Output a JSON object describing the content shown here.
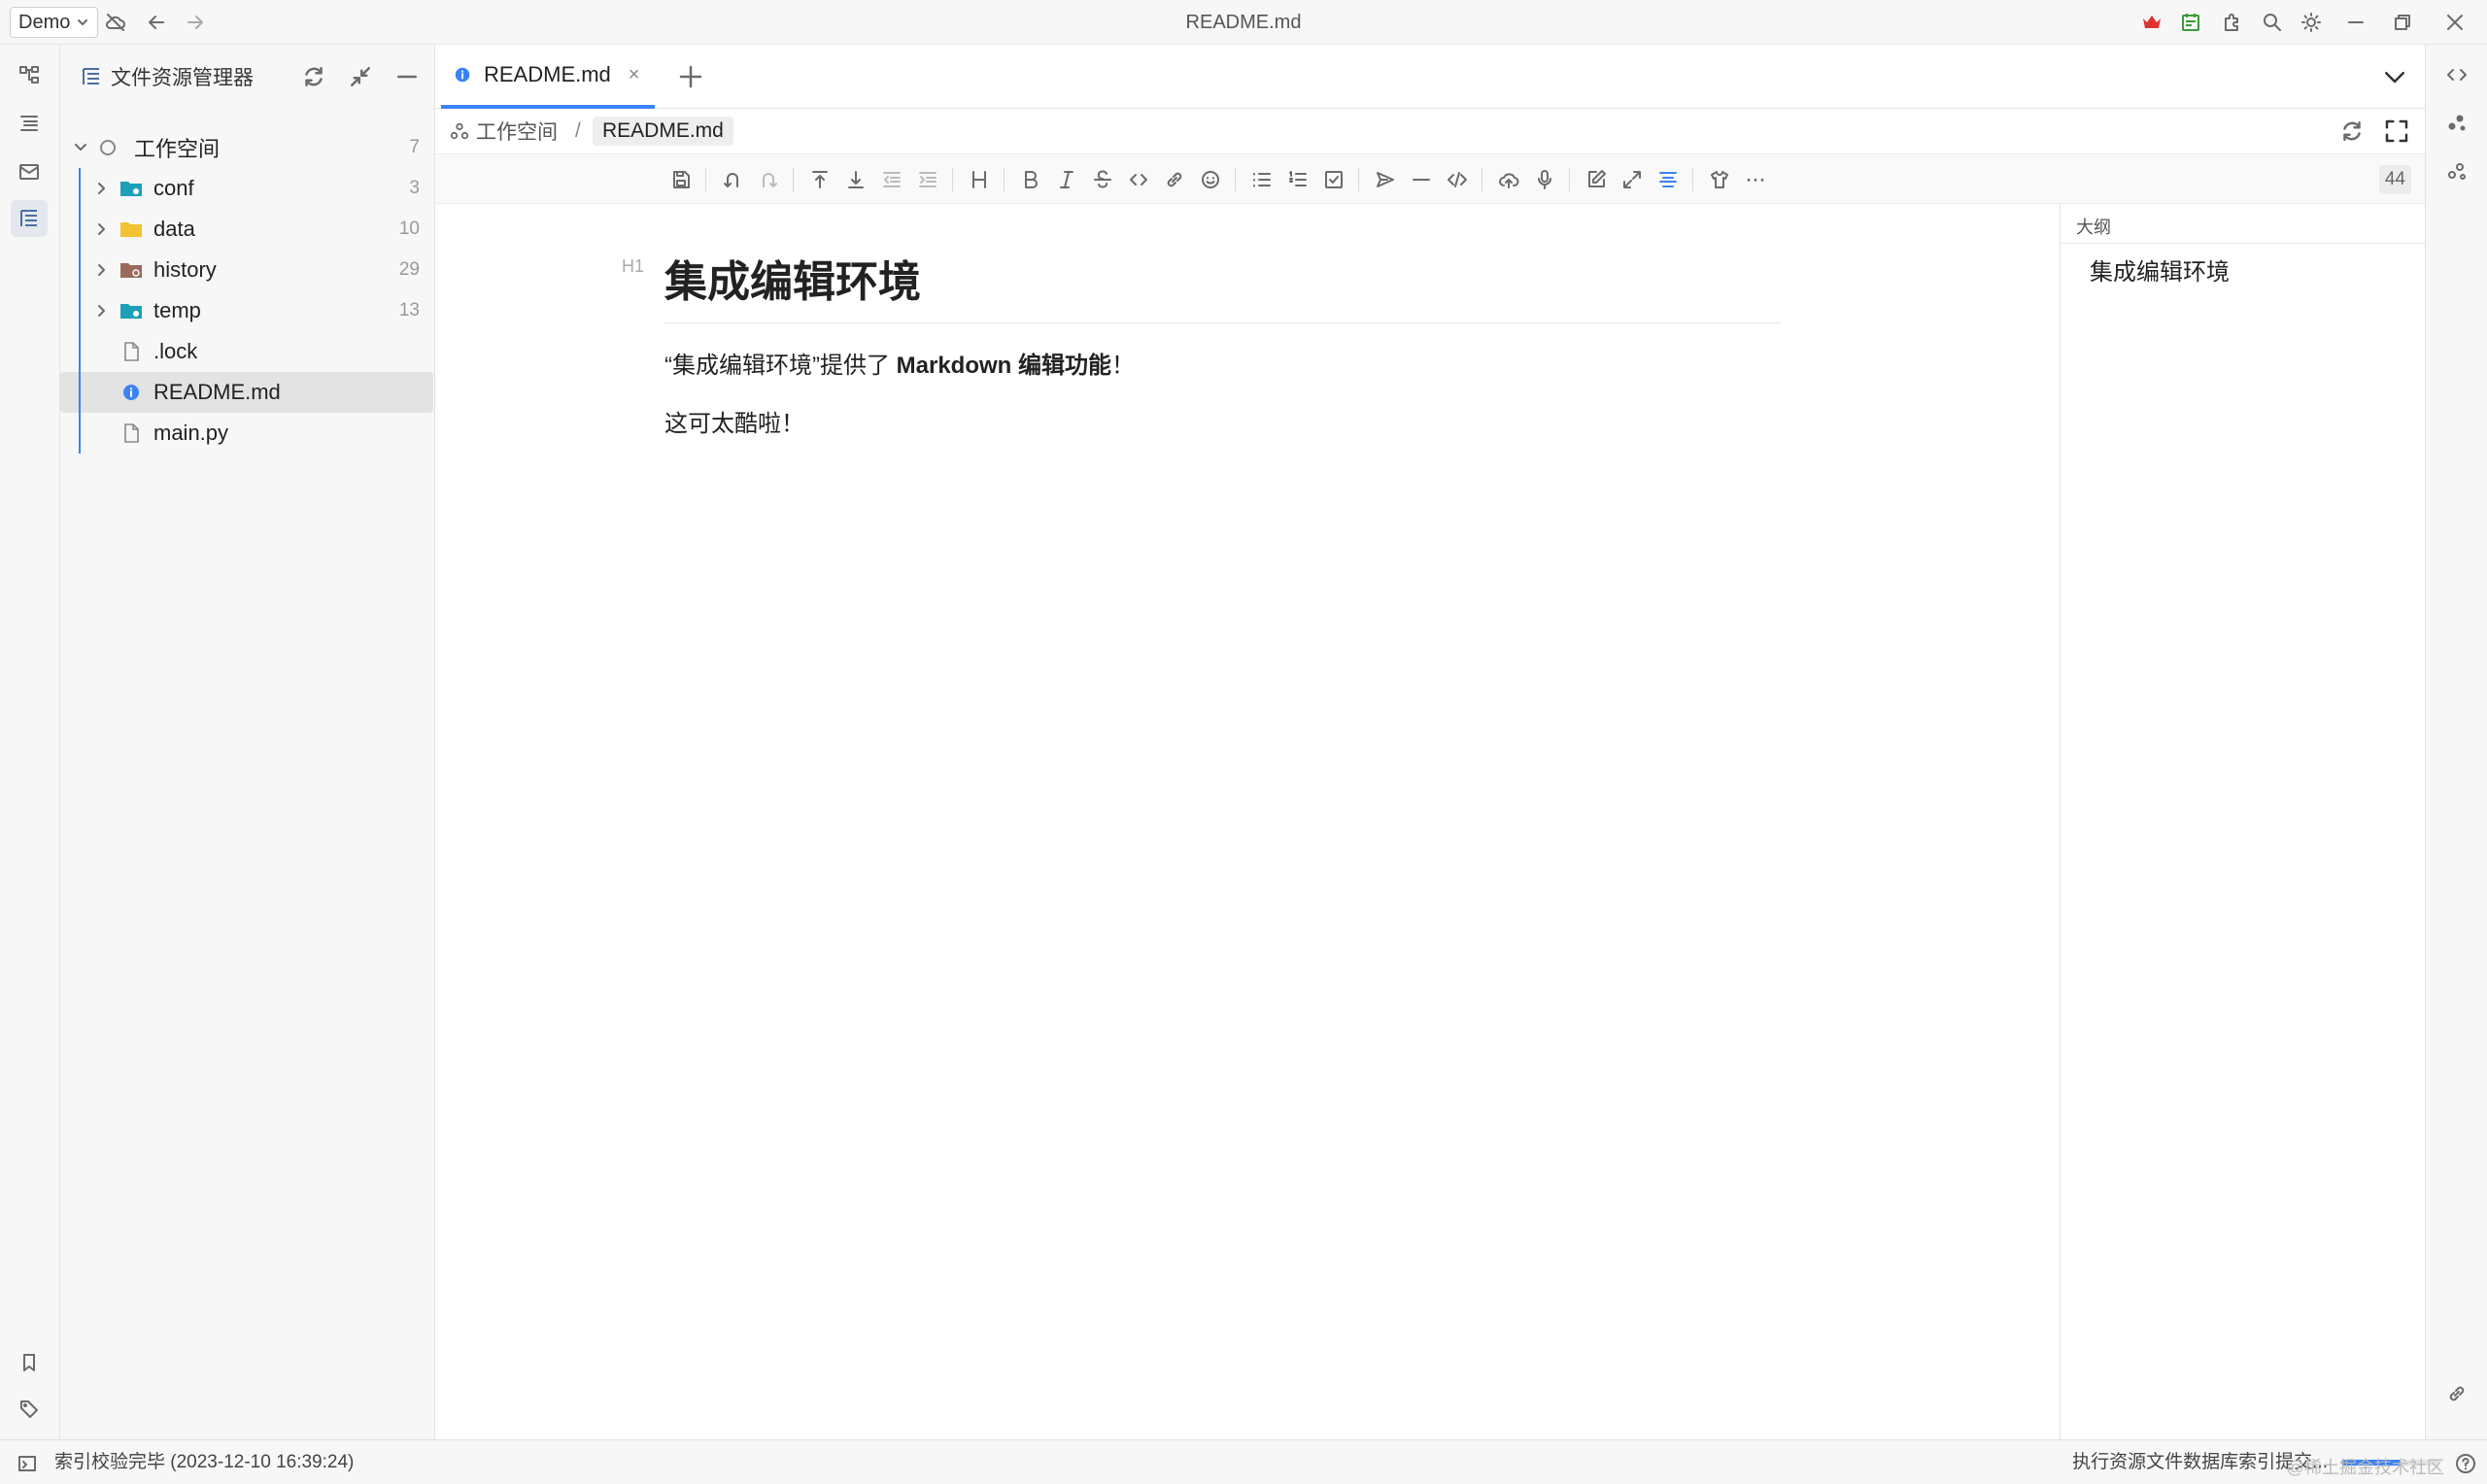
{
  "app": {
    "workspace_select": "Demo",
    "window_title": "README.md"
  },
  "explorer": {
    "title": "文件资源管理器",
    "root": {
      "label": "工作空间",
      "count": "7"
    },
    "items": [
      {
        "label": "conf",
        "count": "3",
        "type": "folder",
        "icon": "folder-teal-icon"
      },
      {
        "label": "data",
        "count": "10",
        "type": "folder",
        "icon": "folder-yellow-icon"
      },
      {
        "label": "history",
        "count": "29",
        "type": "folder",
        "icon": "folder-brown-icon"
      },
      {
        "label": "temp",
        "count": "13",
        "type": "folder",
        "icon": "folder-teal-icon"
      },
      {
        "label": ".lock",
        "count": "",
        "type": "file",
        "icon": "file-icon"
      },
      {
        "label": "README.md",
        "count": "",
        "type": "file",
        "icon": "info-icon",
        "selected": true
      },
      {
        "label": "main.py",
        "count": "",
        "type": "file",
        "icon": "file-icon"
      }
    ]
  },
  "tabs": [
    {
      "label": "README.md",
      "close": "×"
    }
  ],
  "breadcrumb": {
    "root": "工作空间",
    "sep": "/",
    "current": "README.md"
  },
  "toolbar": {
    "word_count": "44"
  },
  "document": {
    "h1_marker": "H1",
    "heading": "集成编辑环境",
    "p1_prefix": "“集成编辑环境”提供了 ",
    "p1_bold": "Markdown 编辑功能",
    "p1_suffix": "！",
    "p2": "这可太酷啦！"
  },
  "outline": {
    "title": "大纲",
    "items": [
      "集成编辑环境"
    ]
  },
  "status": {
    "left": "索引校验完毕 (2023-12-10 16:39:24)",
    "right": "执行资源文件数据库索引提交...",
    "progress": 0.6,
    "watermark": "@稀土掘金技术社区"
  },
  "colors": {
    "accent": "#3b82f6",
    "folder_teal": "#1ca0b8",
    "folder_yellow": "#f2c230",
    "folder_brown": "#9a6a5a"
  }
}
